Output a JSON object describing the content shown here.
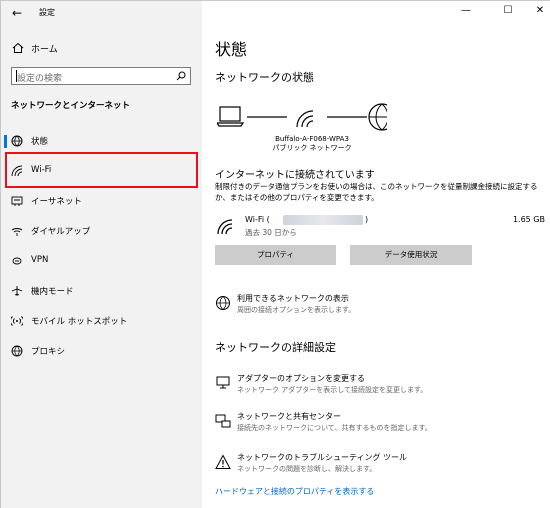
{
  "window": {
    "app_title": "設定",
    "back_icon": "back-arrow-icon",
    "controls": {
      "minimize": "—",
      "maximize": "☐",
      "close": "✕"
    }
  },
  "sidebar": {
    "home_label": "ホーム",
    "search": {
      "placeholder": "設定の検索"
    },
    "section_title": "ネットワークとインターネット",
    "items": [
      {
        "label": "状態",
        "icon": "globe-status-icon",
        "active": true
      },
      {
        "label": "Wi-Fi",
        "icon": "wifi-icon",
        "highlighted": true
      },
      {
        "label": "イーサネット",
        "icon": "ethernet-icon"
      },
      {
        "label": "ダイヤルアップ",
        "icon": "dialup-icon"
      },
      {
        "label": "VPN",
        "icon": "vpn-icon"
      },
      {
        "label": "機内モード",
        "icon": "airplane-icon"
      },
      {
        "label": "モバイル ホットスポット",
        "icon": "hotspot-icon"
      },
      {
        "label": "プロキシ",
        "icon": "proxy-globe-icon"
      }
    ]
  },
  "main": {
    "page_title": "状態",
    "network_status_heading": "ネットワークの状態",
    "network_name": "Buffalo-A-F068-WPA3",
    "network_type": "パブリック ネットワーク",
    "status_title": "インターネットに接続されています",
    "status_description": "制限付きのデータ通信プランをお使いの場合は、このネットワークを従量制課金接続に設定するか、またはその他のプロパティを変更できます。",
    "connection": {
      "name_prefix": "Wi-Fi (",
      "name_suffix": ")",
      "since": "過去 30 日から",
      "data_used": "1.65 GB"
    },
    "buttons": {
      "properties": "プロパティ",
      "data_usage": "データ使用状況"
    },
    "available_networks": {
      "title": "利用できるネットワークの表示",
      "subtitle": "周囲の接続オプションを表示します。"
    },
    "advanced_heading": "ネットワークの詳細設定",
    "advanced_items": [
      {
        "title": "アダプターのオプションを変更する",
        "subtitle": "ネットワーク アダプターを表示して接続設定を変更します。",
        "icon": "adapter-icon"
      },
      {
        "title": "ネットワークと共有センター",
        "subtitle": "接続先のネットワークについて、共有するものを指定します。",
        "icon": "sharing-center-icon"
      },
      {
        "title": "ネットワークのトラブルシューティング ツール",
        "subtitle": "ネットワークの問題を診断し、解決します。",
        "icon": "warning-triangle-icon"
      }
    ],
    "hardware_link": "ハードウェアと接続のプロパティを表示する"
  },
  "colors": {
    "accent": "#0078d7",
    "highlight_box": "#e8101c",
    "sidebar_bg": "#f2f2f2",
    "link": "#0067c0",
    "button_bg": "#cccccc"
  }
}
